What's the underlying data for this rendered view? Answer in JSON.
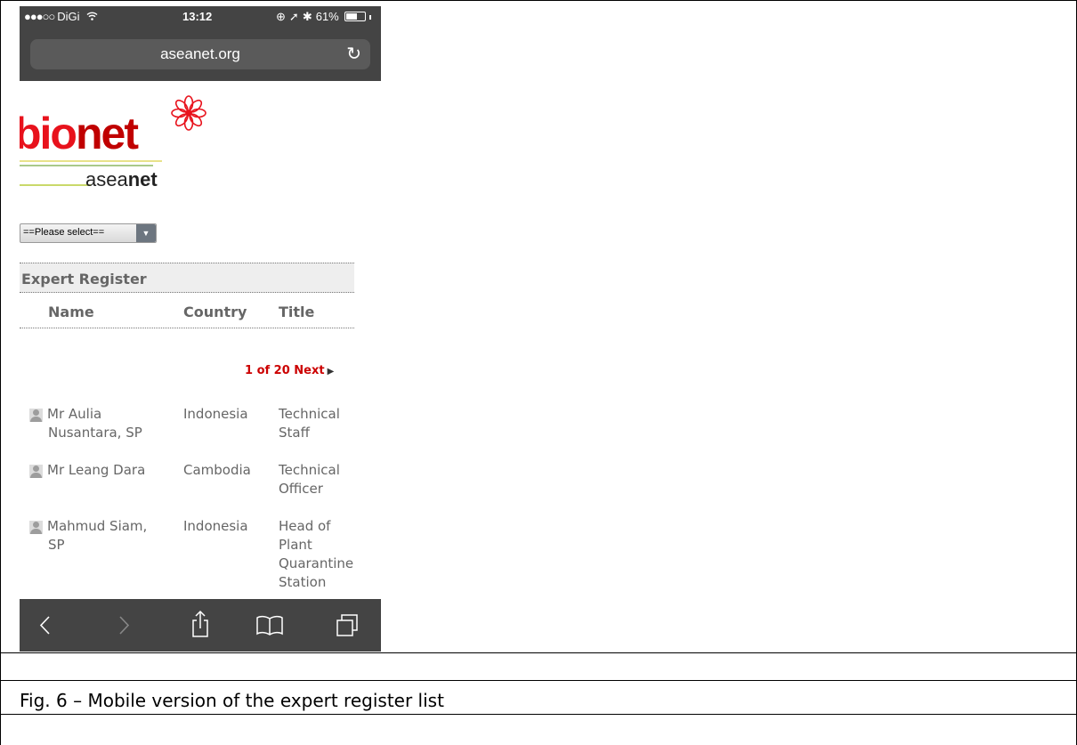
{
  "status_bar": {
    "signal": "●●●○○",
    "carrier": "DiGi",
    "wifi_icon": "wifi-icon",
    "time": "13:12",
    "orientation_lock_icon": "⊕",
    "location_icon": "➚",
    "bluetooth_icon": "✱",
    "battery_text": "61%",
    "battery_level": 0.61
  },
  "browser": {
    "url": "aseanet.org",
    "reload_icon": "↻"
  },
  "logo": {
    "bio": "bio",
    "net": "net",
    "asea": "asea",
    "asea_net": "net"
  },
  "select": {
    "value": "==Please select==",
    "arrow": "▼"
  },
  "register": {
    "title": "Expert Register",
    "columns": [
      "Name",
      "Country",
      "Title"
    ],
    "pager_text": "1 of 20 Next",
    "pager_arrow": "▶",
    "rows": [
      {
        "name_lines": [
          "Mr Aulia",
          "Nusantara, SP"
        ],
        "country": "Indonesia",
        "title_lines": [
          "Technical",
          "Staff"
        ]
      },
      {
        "name_lines": [
          "Mr Leang Dara"
        ],
        "country": "Cambodia",
        "title_lines": [
          "Technical",
          "Officer"
        ]
      },
      {
        "name_lines": [
          "Mahmud Siam,",
          "SP"
        ],
        "country": "Indonesia",
        "title_lines": [
          "Head of",
          "Plant",
          "Quarantine",
          "Station"
        ]
      }
    ]
  },
  "toolbar": {
    "icons": [
      "back-icon",
      "forward-icon",
      "share-icon",
      "bookmarks-icon",
      "tabs-icon"
    ]
  },
  "caption": "Fig. 6 – Mobile version of the expert register list",
  "colors": {
    "browser_chrome": "#444444",
    "brand_red": "#e8121c",
    "pager_red": "#cc0000",
    "text_gray": "#666666"
  }
}
